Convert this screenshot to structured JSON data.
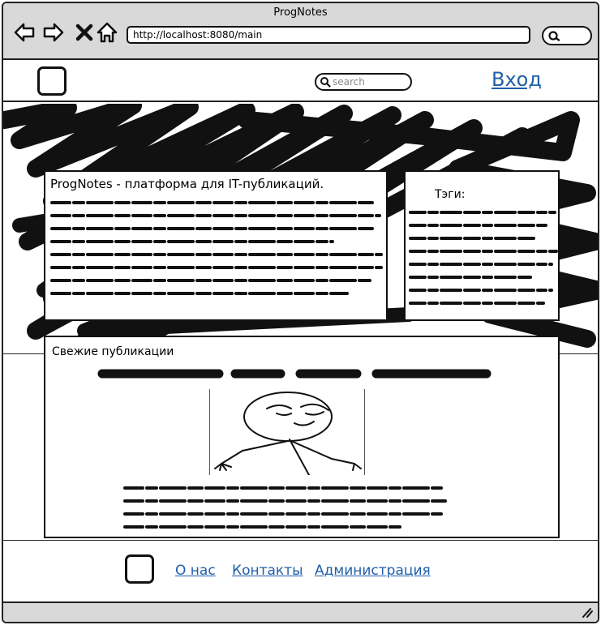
{
  "window": {
    "title": "ProgNotes"
  },
  "browser": {
    "url": "http://localhost:8080/main",
    "icons": [
      "back-arrow-icon",
      "forward-arrow-icon",
      "close-x-icon",
      "home-icon",
      "search-icon"
    ]
  },
  "header": {
    "search_placeholder": "search",
    "login_label": "Вход"
  },
  "about": {
    "title": "ProgNotes - платформа для IT-публикаций."
  },
  "tags": {
    "title": "Тэги:"
  },
  "recent": {
    "title": "Свежие публикации"
  },
  "footer": {
    "links": [
      "О нас",
      "Контакты",
      "Администрация"
    ]
  },
  "colors": {
    "link": "#1f5faa",
    "chrome": "#d9d9d9",
    "ink": "#111111"
  }
}
